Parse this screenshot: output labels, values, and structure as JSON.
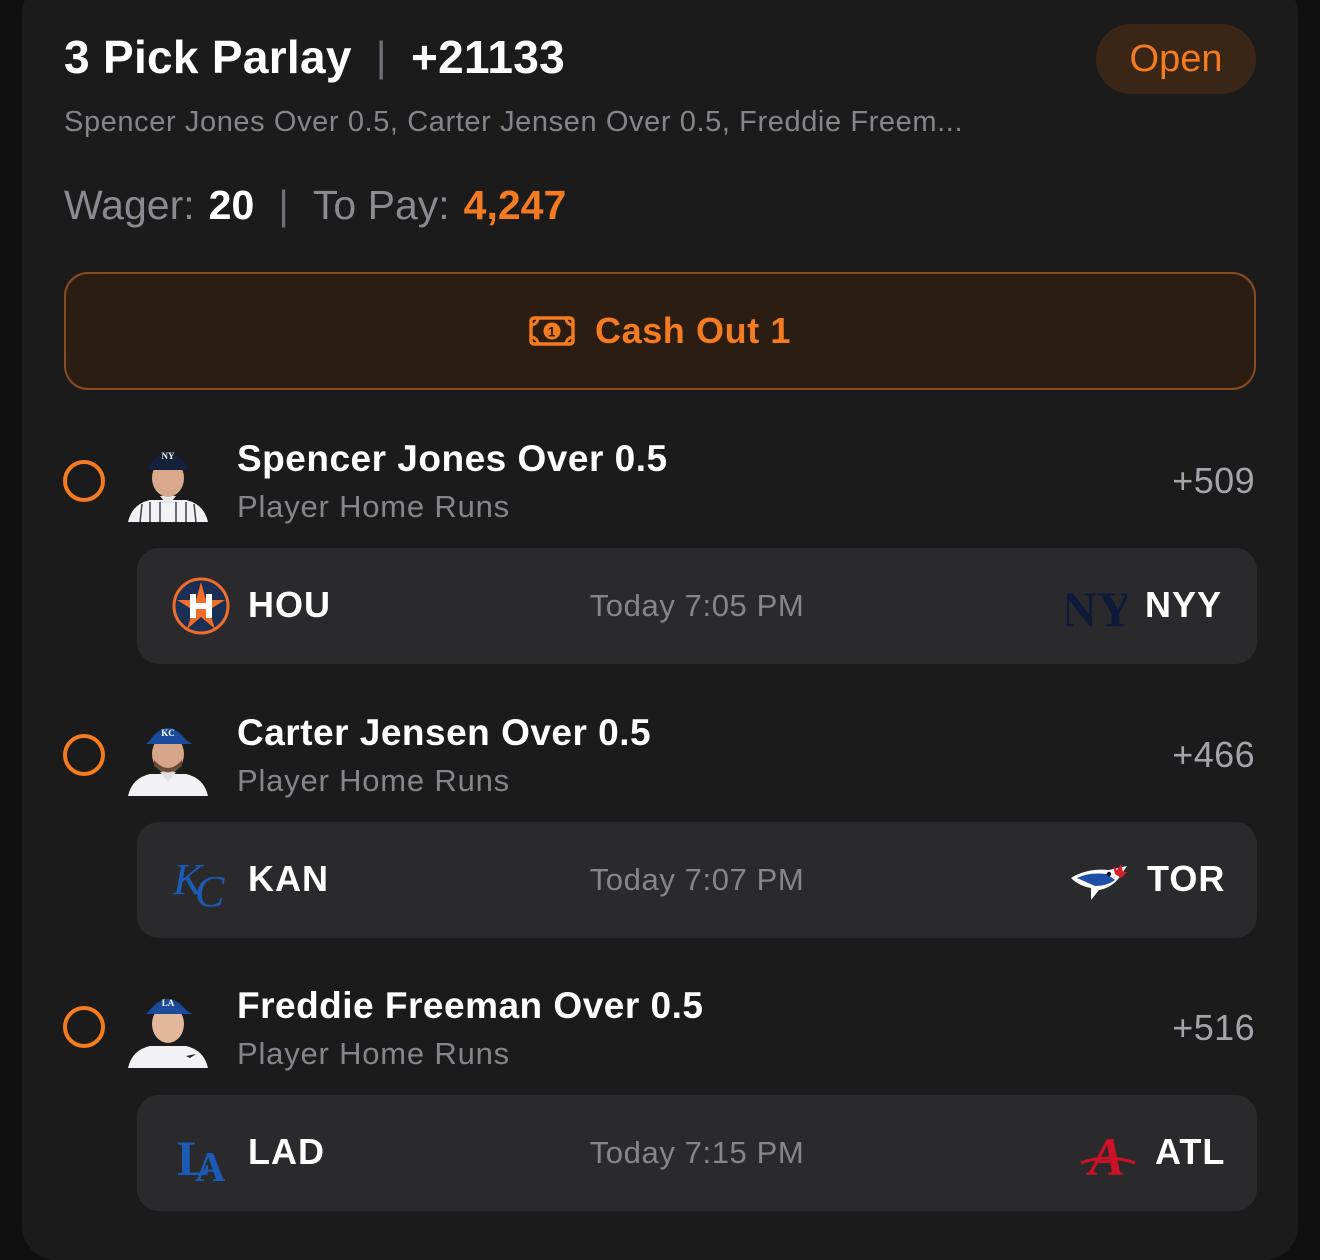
{
  "bet": {
    "title": "3 Pick Parlay",
    "odds": "+21133",
    "status": "Open",
    "summary": "Spencer Jones Over 0.5, Carter Jensen Over 0.5, Freddie Freem...",
    "wager_label": "Wager:",
    "wager_value": "20",
    "to_pay_label": "To Pay:",
    "to_pay_value": "4,247",
    "cashout_label": "Cash Out 1"
  },
  "colors": {
    "accent": "#f47b20",
    "card_bg": "#1b1b1c",
    "game_bg": "#2a2a2c",
    "muted_text": "#85858b"
  },
  "picks": [
    {
      "title": "Spencer Jones Over 0.5",
      "market": "Player Home Runs",
      "odds": "+509",
      "avatar_icon": "player-headshot-yankees",
      "game": {
        "away": "HOU",
        "away_icon": "astros-logo-icon",
        "time": "Today 7:05 PM",
        "home": "NYY",
        "home_icon": "yankees-logo-icon"
      }
    },
    {
      "title": "Carter Jensen Over 0.5",
      "market": "Player Home Runs",
      "odds": "+466",
      "avatar_icon": "player-headshot-royals",
      "game": {
        "away": "KAN",
        "away_icon": "royals-logo-icon",
        "time": "Today 7:07 PM",
        "home": "TOR",
        "home_icon": "blue-jays-logo-icon"
      }
    },
    {
      "title": "Freddie Freeman Over 0.5",
      "market": "Player Home Runs",
      "odds": "+516",
      "avatar_icon": "player-headshot-dodgers",
      "game": {
        "away": "LAD",
        "away_icon": "dodgers-logo-icon",
        "time": "Today 7:15 PM",
        "home": "ATL",
        "home_icon": "braves-logo-icon"
      }
    }
  ]
}
